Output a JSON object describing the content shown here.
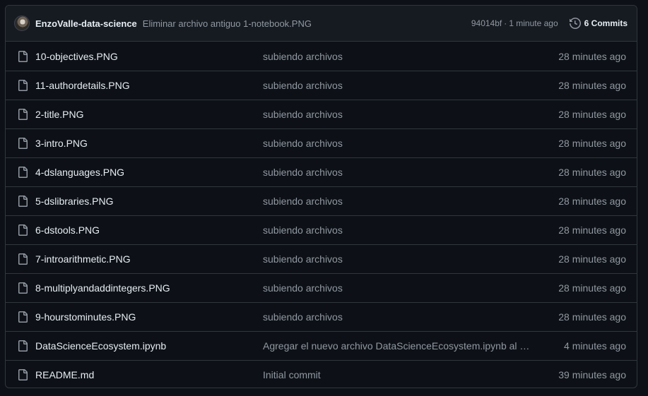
{
  "latest_commit": {
    "author": "EnzoValle-data-science",
    "message": "Eliminar archivo antiguo 1-notebook.PNG",
    "sha": "94014bf",
    "separator": "·",
    "time": "1 minute ago",
    "commits_label": "6 Commits"
  },
  "files": [
    {
      "name": "10-objectives.PNG",
      "message": "subiendo archivos",
      "time": "28 minutes ago",
      "icon": "file-icon"
    },
    {
      "name": "11-authordetails.PNG",
      "message": "subiendo archivos",
      "time": "28 minutes ago",
      "icon": "file-icon"
    },
    {
      "name": "2-title.PNG",
      "message": "subiendo archivos",
      "time": "28 minutes ago",
      "icon": "file-icon"
    },
    {
      "name": "3-intro.PNG",
      "message": "subiendo archivos",
      "time": "28 minutes ago",
      "icon": "file-icon"
    },
    {
      "name": "4-dslanguages.PNG",
      "message": "subiendo archivos",
      "time": "28 minutes ago",
      "icon": "file-icon"
    },
    {
      "name": "5-dslibraries.PNG",
      "message": "subiendo archivos",
      "time": "28 minutes ago",
      "icon": "file-icon"
    },
    {
      "name": "6-dstools.PNG",
      "message": "subiendo archivos",
      "time": "28 minutes ago",
      "icon": "file-icon"
    },
    {
      "name": "7-introarithmetic.PNG",
      "message": "subiendo archivos",
      "time": "28 minutes ago",
      "icon": "file-icon"
    },
    {
      "name": "8-multiplyandaddintegers.PNG",
      "message": "subiendo archivos",
      "time": "28 minutes ago",
      "icon": "file-icon"
    },
    {
      "name": "9-hourstominutes.PNG",
      "message": "subiendo archivos",
      "time": "28 minutes ago",
      "icon": "file-icon"
    },
    {
      "name": "DataScienceEcosystem.ipynb",
      "message": "Agregar el nuevo archivo DataScienceEcosystem.ipynb al re...",
      "time": "4 minutes ago",
      "icon": "file-icon"
    },
    {
      "name": "README.md",
      "message": "Initial commit",
      "time": "39 minutes ago",
      "icon": "file-icon"
    }
  ],
  "colors": {
    "background": "#0d1117",
    "header_background": "#161b22",
    "border": "#30363d",
    "text_primary": "#e6edf3",
    "text_muted": "#9198a1"
  }
}
